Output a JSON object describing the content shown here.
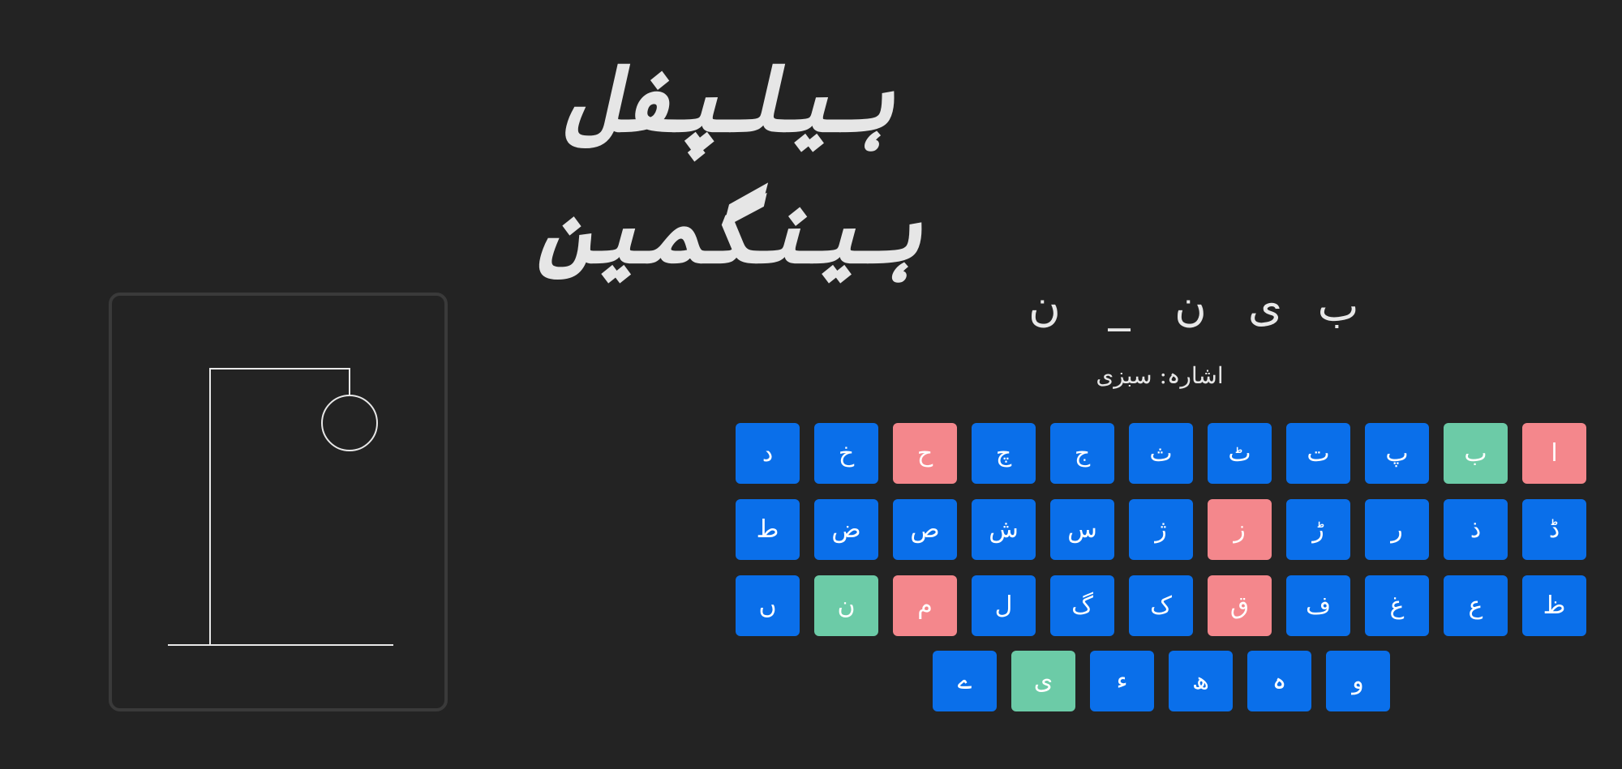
{
  "game": {
    "title": "ہیلپفل ہینگمین",
    "hint": "اشارہ: سبزی",
    "word": [
      "ب",
      "ی",
      "ن",
      "_",
      "ن"
    ],
    "wrong_guesses": 2
  },
  "colors": {
    "background": "#232323",
    "key_default": "#0a6fea",
    "key_correct": "#6ccba7",
    "key_wrong": "#f4878c",
    "drawing": "#e8e8e8",
    "box_border": "#3a3a3a"
  },
  "keyboard": {
    "rows": [
      [
        {
          "letter": "ا",
          "state": "wrong"
        },
        {
          "letter": "ب",
          "state": "correct"
        },
        {
          "letter": "پ",
          "state": "default"
        },
        {
          "letter": "ت",
          "state": "default"
        },
        {
          "letter": "ٹ",
          "state": "default"
        },
        {
          "letter": "ث",
          "state": "default"
        },
        {
          "letter": "ج",
          "state": "default"
        },
        {
          "letter": "چ",
          "state": "default"
        },
        {
          "letter": "ح",
          "state": "wrong"
        },
        {
          "letter": "خ",
          "state": "default"
        },
        {
          "letter": "د",
          "state": "default"
        }
      ],
      [
        {
          "letter": "ڈ",
          "state": "default"
        },
        {
          "letter": "ذ",
          "state": "default"
        },
        {
          "letter": "ر",
          "state": "default"
        },
        {
          "letter": "ڑ",
          "state": "default"
        },
        {
          "letter": "ز",
          "state": "wrong"
        },
        {
          "letter": "ژ",
          "state": "default"
        },
        {
          "letter": "س",
          "state": "default"
        },
        {
          "letter": "ش",
          "state": "default"
        },
        {
          "letter": "ص",
          "state": "default"
        },
        {
          "letter": "ض",
          "state": "default"
        },
        {
          "letter": "ط",
          "state": "default"
        }
      ],
      [
        {
          "letter": "ظ",
          "state": "default"
        },
        {
          "letter": "ع",
          "state": "default"
        },
        {
          "letter": "غ",
          "state": "default"
        },
        {
          "letter": "ف",
          "state": "default"
        },
        {
          "letter": "ق",
          "state": "wrong"
        },
        {
          "letter": "ک",
          "state": "default"
        },
        {
          "letter": "گ",
          "state": "default"
        },
        {
          "letter": "ل",
          "state": "default"
        },
        {
          "letter": "م",
          "state": "wrong"
        },
        {
          "letter": "ن",
          "state": "correct"
        },
        {
          "letter": "ں",
          "state": "default"
        }
      ],
      [
        {
          "letter": "و",
          "state": "default"
        },
        {
          "letter": "ہ",
          "state": "default"
        },
        {
          "letter": "ھ",
          "state": "default"
        },
        {
          "letter": "ء",
          "state": "default"
        },
        {
          "letter": "ی",
          "state": "correct"
        },
        {
          "letter": "ے",
          "state": "default"
        }
      ]
    ]
  }
}
